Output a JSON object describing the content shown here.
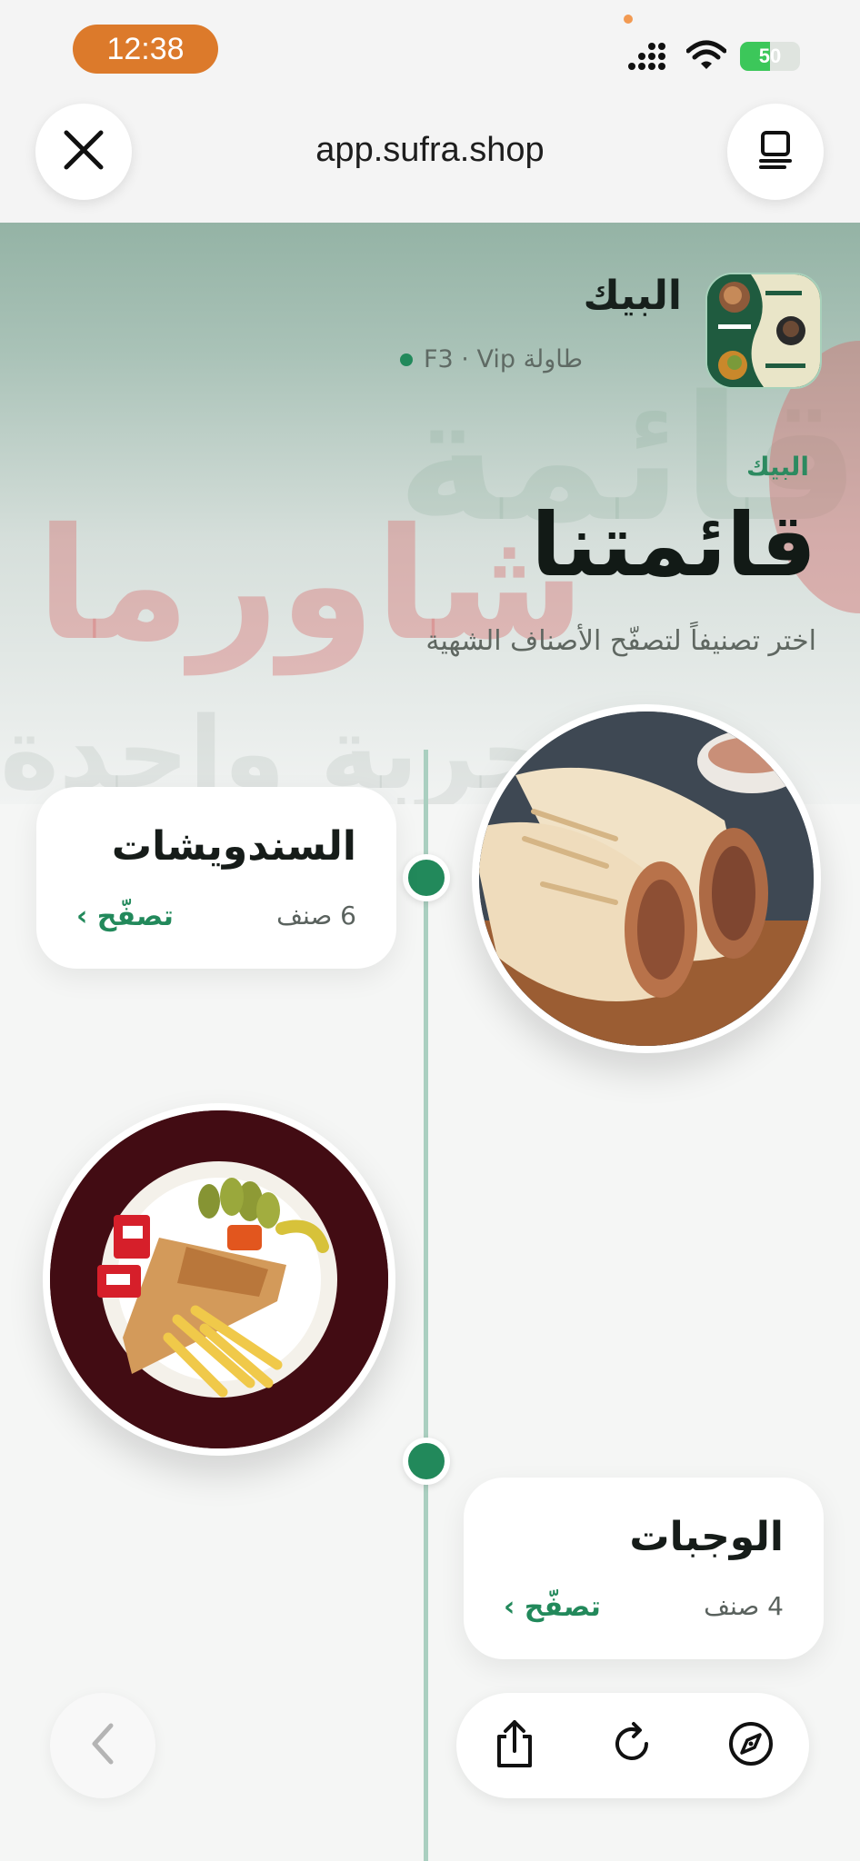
{
  "status_bar": {
    "time": "12:38",
    "battery": "50",
    "battery_level": 0.5
  },
  "browser": {
    "url": "app.sufra.shop"
  },
  "header": {
    "restaurant_name": "البيك",
    "table_label": "طاولة F3 · Vip",
    "logo_items": [
      "Beef Pizza",
      "Black Burger",
      "Chicken Steak"
    ]
  },
  "hero": {
    "eyebrow": "البيك",
    "title": "قائمتنا",
    "subtitle": "اختر تصنيفاً لتصفّح الأصناف الشهية",
    "background_words": [
      "قائمة",
      "شاورما",
      "تجربة واحدة"
    ]
  },
  "categories": [
    {
      "name": "السندويشات",
      "count": "6 صنف",
      "browse": "تصفّح ›"
    },
    {
      "name": "الوجبات",
      "count": "4 صنف",
      "browse": "تصفّح ›"
    }
  ],
  "icons": {
    "close": "close-icon",
    "tabs": "tabs-icon",
    "back": "chevron-left-icon",
    "share": "share-icon",
    "reload": "reload-icon",
    "compass": "compass-icon"
  },
  "colors": {
    "accent": "#22895b",
    "time_pill": "#dc7a2b",
    "battery": "#3cc75a"
  }
}
